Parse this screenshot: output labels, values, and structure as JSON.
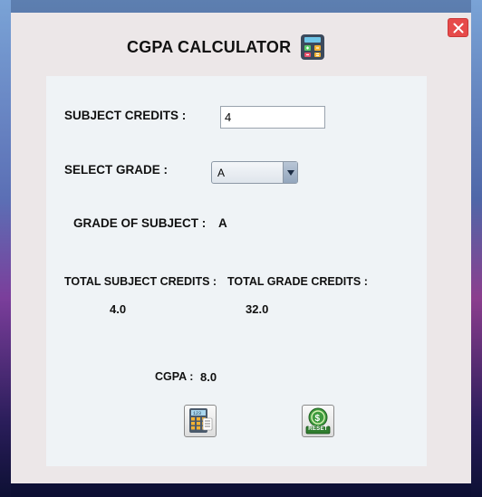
{
  "window": {
    "title": "CGPA CALCULATOR",
    "close_icon": "close-icon",
    "title_icon": "calculator-icon"
  },
  "form": {
    "subject_credits_label": "SUBJECT CREDITS   :",
    "subject_credits_value": "4",
    "select_grade_label": "SELECT GRADE  :",
    "select_grade_value": "A",
    "grade_of_subject_label": "GRADE OF SUBJECT :",
    "grade_of_subject_value": "A"
  },
  "totals": {
    "total_subject_credits_label": "TOTAL SUBJECT CREDITS :",
    "total_subject_credits_value": "4.0",
    "total_grade_credits_label": "TOTAL GRADE CREDITS :",
    "total_grade_credits_value": "32.0",
    "cgpa_label": "CGPA :",
    "cgpa_value": "8.0"
  },
  "actions": {
    "calculate_icon": "calculator-icon",
    "reset_label": "RESET",
    "reset_icon": "reset-icon"
  },
  "colors": {
    "close_button": "#e64a4a",
    "window_bg": "#ece7e8",
    "panel_bg": "#eff3f6"
  }
}
